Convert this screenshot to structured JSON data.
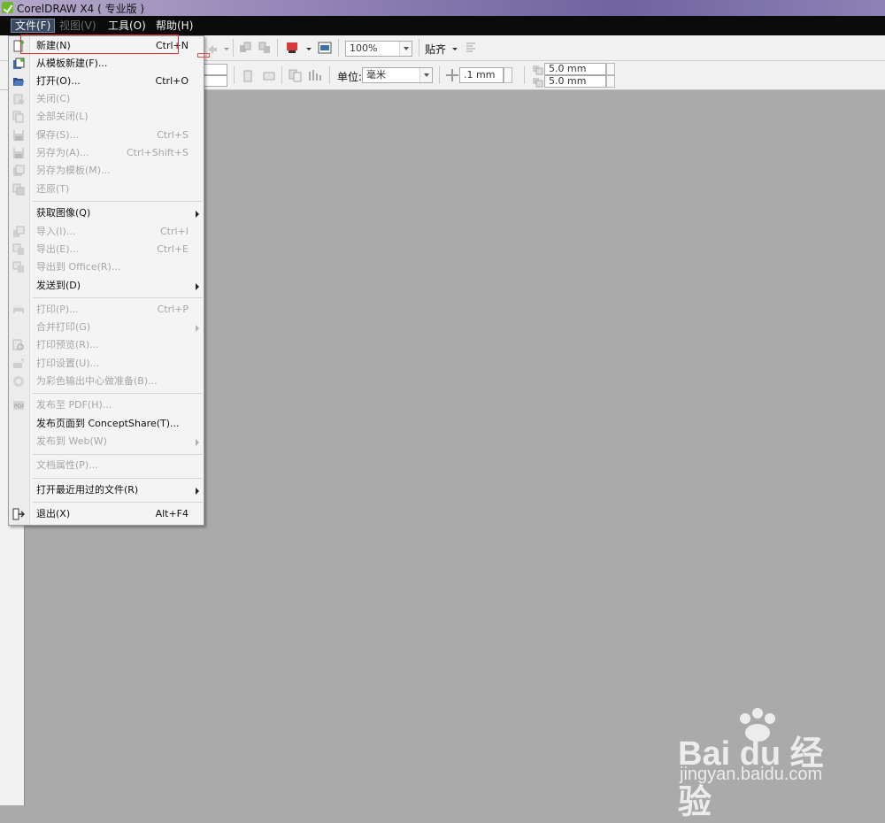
{
  "window": {
    "title": "CorelDRAW X4 ( 专业版 )"
  },
  "menubar": {
    "items": [
      {
        "label": "文件(F)",
        "state": "active"
      },
      {
        "label": "视图(V)",
        "state": "dim"
      },
      {
        "label": "工具(O)",
        "state": "normal"
      },
      {
        "label": "帮助(H)",
        "state": "normal"
      }
    ]
  },
  "toolbar": {
    "zoom": "100%",
    "snap_label": "贴齐",
    "unit_label": "单位:",
    "unit_value": "毫米",
    "nudge_value": ".1 mm",
    "dup_x": "5.0 mm",
    "dup_y": "5.0 mm"
  },
  "file_menu": {
    "items": [
      {
        "label": "新建(N)",
        "shortcut": "Ctrl+N",
        "enabled": true,
        "icon": "new-document-icon"
      },
      {
        "label": "从模板新建(F)...",
        "shortcut": "",
        "enabled": true,
        "icon": "new-from-template-icon"
      },
      {
        "label": "打开(O)...",
        "shortcut": "Ctrl+O",
        "enabled": true,
        "icon": "open-folder-icon"
      },
      {
        "label": "关闭(C)",
        "shortcut": "",
        "enabled": false,
        "icon": "close-document-icon"
      },
      {
        "label": "全部关闭(L)",
        "shortcut": "",
        "enabled": false,
        "icon": "close-all-icon"
      },
      {
        "label": "保存(S)...",
        "shortcut": "Ctrl+S",
        "enabled": false,
        "icon": "save-icon"
      },
      {
        "label": "另存为(A)...",
        "shortcut": "Ctrl+Shift+S",
        "enabled": false,
        "icon": "save-as-icon"
      },
      {
        "label": "另存为模板(M)...",
        "shortcut": "",
        "enabled": false,
        "icon": "save-as-template-icon"
      },
      {
        "label": "还原(T)",
        "shortcut": "",
        "enabled": false,
        "icon": "revert-icon"
      },
      {
        "label": "获取图像(Q)",
        "shortcut": "",
        "enabled": true,
        "submenu": true,
        "icon": ""
      },
      {
        "label": "导入(I)...",
        "shortcut": "Ctrl+I",
        "enabled": false,
        "icon": "import-icon"
      },
      {
        "label": "导出(E)...",
        "shortcut": "Ctrl+E",
        "enabled": false,
        "icon": "export-icon"
      },
      {
        "label": "导出到 Office(R)...",
        "shortcut": "",
        "enabled": false,
        "icon": "export-office-icon"
      },
      {
        "label": "发送到(D)",
        "shortcut": "",
        "enabled": true,
        "submenu": true,
        "icon": ""
      },
      {
        "label": "打印(P)...",
        "shortcut": "Ctrl+P",
        "enabled": false,
        "icon": "printer-icon"
      },
      {
        "label": "合并打印(G)",
        "shortcut": "",
        "enabled": false,
        "submenu": true,
        "icon": ""
      },
      {
        "label": "打印预览(R)...",
        "shortcut": "",
        "enabled": false,
        "icon": "print-preview-icon"
      },
      {
        "label": "打印设置(U)...",
        "shortcut": "",
        "enabled": false,
        "icon": "print-setup-icon"
      },
      {
        "label": "为彩色输出中心做准备(B)...",
        "shortcut": "",
        "enabled": false,
        "icon": "color-output-icon"
      },
      {
        "label": "发布至 PDF(H)...",
        "shortcut": "",
        "enabled": false,
        "icon": "pdf-icon"
      },
      {
        "label": "发布页面到 ConceptShare(T)...",
        "shortcut": "",
        "enabled": true,
        "icon": ""
      },
      {
        "label": "发布到 Web(W)",
        "shortcut": "",
        "enabled": false,
        "submenu": true,
        "icon": ""
      },
      {
        "label": "文档属性(P)...",
        "shortcut": "",
        "enabled": false,
        "icon": ""
      },
      {
        "label": "打开最近用过的文件(R)",
        "shortcut": "",
        "enabled": true,
        "submenu": true,
        "icon": ""
      },
      {
        "label": "退出(X)",
        "shortcut": "Alt+F4",
        "enabled": true,
        "icon": "exit-icon"
      }
    ]
  },
  "watermark": {
    "logo": "Bai du 经验",
    "url": "jingyan.baidu.com"
  },
  "colors": {
    "menubar_bg": "#0b0b0b",
    "canvas_bg": "#aaaaaa",
    "highlight": "#e03030",
    "title_gradient": "#8d7fb3"
  }
}
